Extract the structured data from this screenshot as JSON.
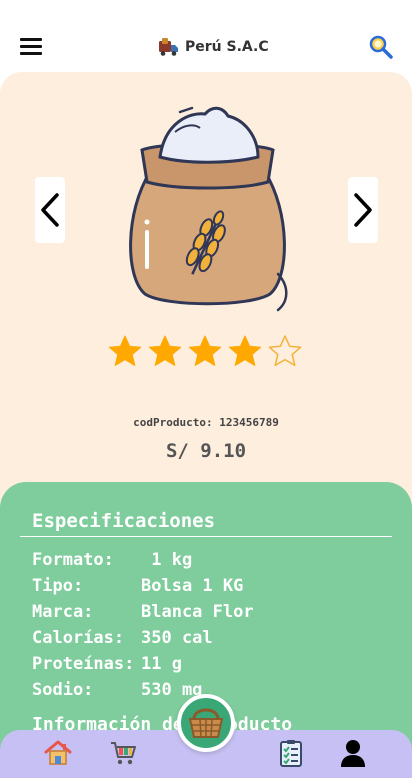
{
  "header": {
    "brand_title": "Perú S.A.C",
    "menu_icon": "hamburger-menu-icon",
    "logo_icon": "delivery-truck-icon",
    "search_icon": "search-icon"
  },
  "product": {
    "image_icon": "flour-sack-icon",
    "rating": 4,
    "rating_max": 5,
    "code_line": "codProducto: 123456789",
    "price": "S/ 9.10"
  },
  "specs": {
    "title": "Especificaciones",
    "rows": [
      {
        "label": "Formato:",
        "value": " 1 kg"
      },
      {
        "label": "Tipo:",
        "value": "Bolsa 1 KG"
      },
      {
        "label": "Marca:",
        "value": "Blanca Flor"
      },
      {
        "label": "Calorías:",
        "value": "350 cal"
      },
      {
        "label": "Proteínas:",
        "value": "11 g"
      },
      {
        "label": "Sodio:",
        "value": "530 mg"
      }
    ],
    "info_title": "Información del producto"
  },
  "nav": {
    "items": [
      "home-icon",
      "cart-icon",
      "basket-icon",
      "checklist-icon",
      "user-icon"
    ]
  },
  "colors": {
    "product_bg": "#fdeedd",
    "spec_bg": "#7fcc9c",
    "nav_bg": "#c7c0f4",
    "star": "#ffa800",
    "fab": "#3aa776"
  }
}
